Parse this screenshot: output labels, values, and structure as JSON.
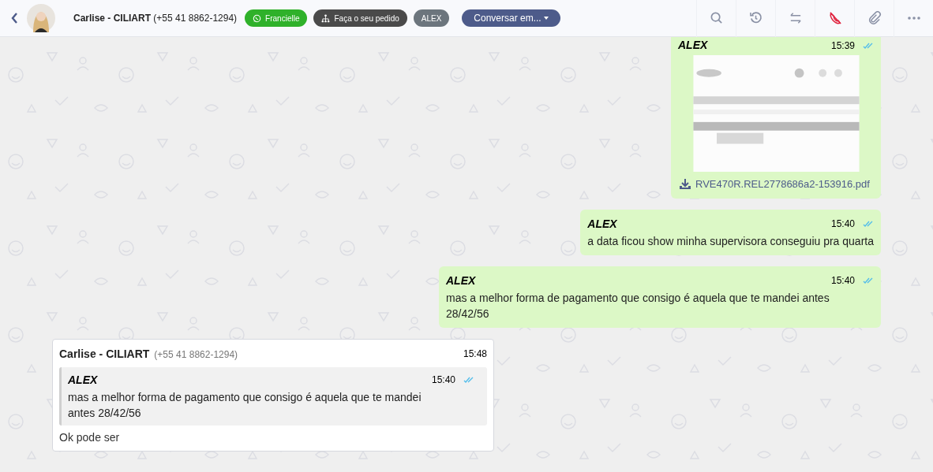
{
  "header": {
    "contact_name": "Carlise - CILIART",
    "contact_phone": "(+55 41 8862-1294)",
    "tags": [
      {
        "kind": "whatsapp",
        "label": "Francielle"
      },
      {
        "kind": "flow",
        "label": "Faça o seu pedido"
      },
      {
        "kind": "agent",
        "label": "ALEX"
      }
    ],
    "dropdown": "Conversar em...",
    "call_muted": true
  },
  "messages": [
    {
      "kind": "document",
      "sender": "ALEX",
      "time": "15:39",
      "read": true,
      "filename": "RVE470R.REL2778686a2-153916.pdf"
    },
    {
      "kind": "text",
      "sender": "ALEX",
      "time": "15:40",
      "read": true,
      "text": "a data ficou show minha supervisora conseguiu pra quarta"
    },
    {
      "kind": "text",
      "sender": "ALEX",
      "time": "15:40",
      "read": true,
      "text": "mas a melhor forma de pagamento que consigo é aquela que te mandei antes 28/42/56"
    },
    {
      "kind": "reply",
      "sender": "Carlise - CILIART",
      "phone": "(+55 41 8862-1294)",
      "time": "15:48",
      "quote": {
        "sender": "ALEX",
        "time": "15:40",
        "read": true,
        "text": "mas a melhor forma de pagamento que consigo é aquela que te mandei antes 28/42/56"
      },
      "text": "Ok pode ser"
    }
  ]
}
